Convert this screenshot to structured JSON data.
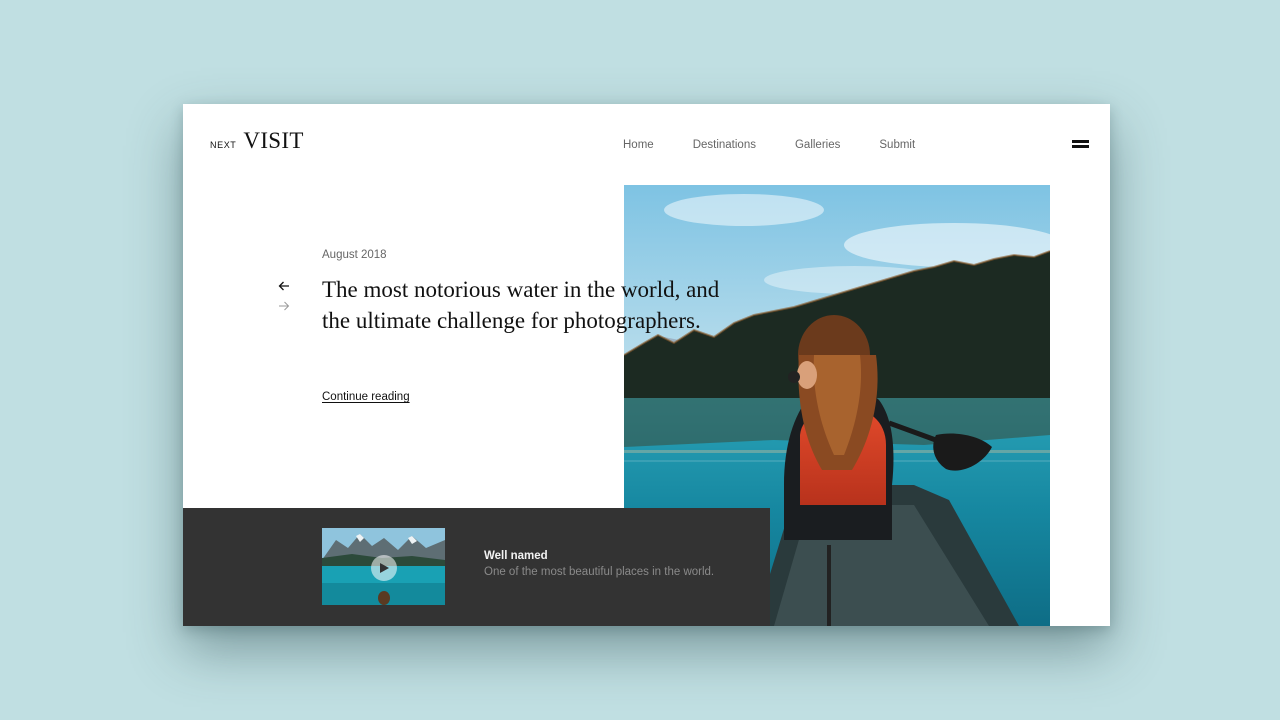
{
  "logo": {
    "prefix": "NEXT",
    "name": "VISIT"
  },
  "nav": {
    "items": [
      "Home",
      "Destinations",
      "Galleries",
      "Submit"
    ]
  },
  "icons": {
    "menu": "hamburger-menu-icon",
    "prev": "arrow-left-icon",
    "next": "arrow-right-icon",
    "play": "play-icon"
  },
  "hero": {
    "date": "August 2018",
    "headline": "The most notorious water in the world, and the ultimate challenge for photographers.",
    "cta": "Continue reading"
  },
  "featured": {
    "title": "Well named",
    "description": "One of the most beautiful places in the world."
  },
  "colors": {
    "background": "#c0dfe2",
    "card": "#ffffff",
    "bottom_bar": "#333333",
    "text": "#111111",
    "muted": "#666666",
    "lake": "#1f8fa3"
  }
}
